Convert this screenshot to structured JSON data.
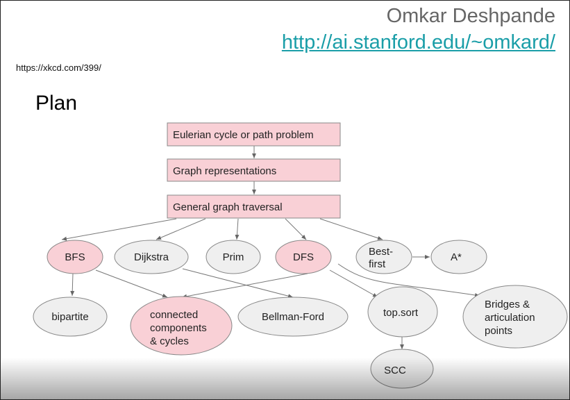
{
  "header": {
    "author": "Omkar Deshpande",
    "url": "http://ai.stanford.edu/~omkard/",
    "reference": "https://xkcd.com/399/"
  },
  "slide_title": "Plan",
  "colors": {
    "highlight_fill": "#f9d0d6",
    "plain_fill": "#efefef",
    "link": "#1a9ea8"
  },
  "nodes": {
    "euler": "Eulerian cycle or path problem",
    "repr": "Graph representations",
    "trav": "General graph traversal",
    "bfs": "BFS",
    "dijkstra": "Dijkstra",
    "prim": "Prim",
    "dfs": "DFS",
    "best1": "Best-",
    "best2": "first",
    "astar": "A*",
    "bipartite": "bipartite",
    "cc1": "connected",
    "cc2": "components",
    "cc3": "& cycles",
    "bellman": "Bellman-Ford",
    "topsort": "top.sort",
    "br1": "Bridges &",
    "br2": "articulation",
    "br3": "points",
    "scc": "SCC"
  },
  "edges": [
    [
      "euler",
      "repr"
    ],
    [
      "repr",
      "trav"
    ],
    [
      "trav",
      "bfs"
    ],
    [
      "trav",
      "dijkstra"
    ],
    [
      "trav",
      "prim"
    ],
    [
      "trav",
      "dfs"
    ],
    [
      "trav",
      "best-first"
    ],
    [
      "best-first",
      "astar"
    ],
    [
      "bfs",
      "bipartite"
    ],
    [
      "bfs",
      "connected-components"
    ],
    [
      "dfs",
      "connected-components"
    ],
    [
      "dijkstra",
      "bellman-ford"
    ],
    [
      "dfs",
      "topsort"
    ],
    [
      "dfs",
      "bridges"
    ],
    [
      "topsort",
      "scc"
    ]
  ]
}
